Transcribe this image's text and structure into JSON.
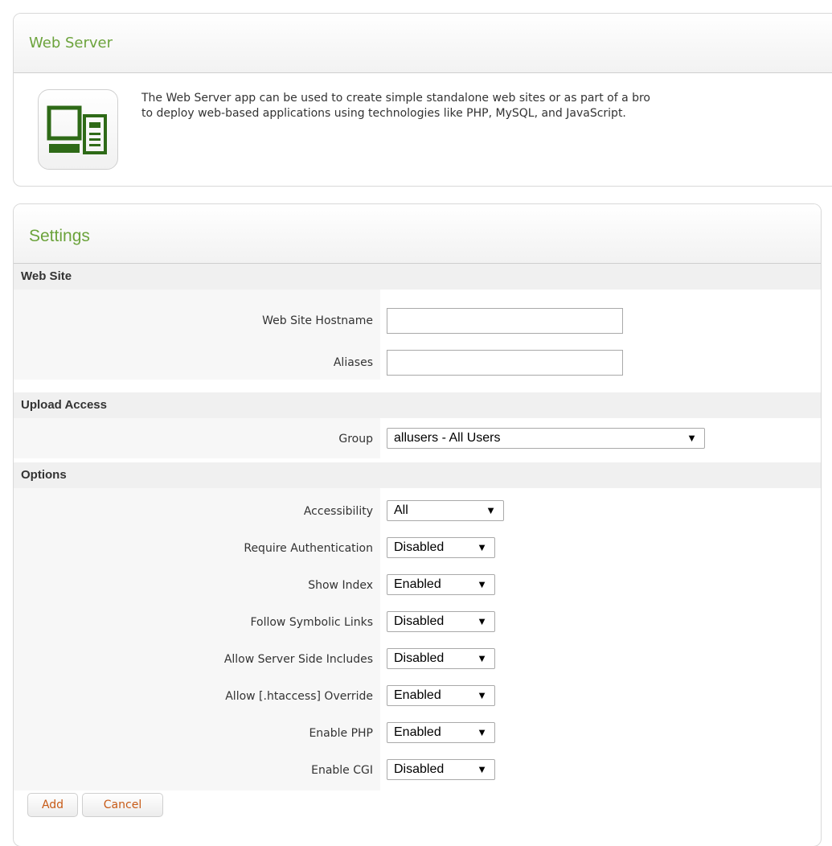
{
  "app": {
    "title": "Web Server",
    "icon": "web-server-icon",
    "description_line1": "The Web Server app can be used to create simple standalone web sites or as part of a bro",
    "description_line2": "to deploy web-based applications using technologies like PHP, MySQL, and JavaScript."
  },
  "settings": {
    "title": "Settings",
    "sections": {
      "web_site": "Web Site",
      "upload_access": "Upload Access",
      "options": "Options"
    },
    "fields": {
      "hostname": {
        "label": "Web Site Hostname",
        "value": ""
      },
      "aliases": {
        "label": "Aliases",
        "value": ""
      },
      "group": {
        "label": "Group",
        "value": "allusers - All Users"
      },
      "accessibility": {
        "label": "Accessibility",
        "value": "All"
      },
      "require_auth": {
        "label": "Require Authentication",
        "value": "Disabled"
      },
      "show_index": {
        "label": "Show Index",
        "value": "Enabled"
      },
      "follow_symlinks": {
        "label": "Follow Symbolic Links",
        "value": "Disabled"
      },
      "ssi": {
        "label": "Allow Server Side Includes",
        "value": "Disabled"
      },
      "htaccess": {
        "label": "Allow [.htaccess] Override",
        "value": "Enabled"
      },
      "php": {
        "label": "Enable PHP",
        "value": "Enabled"
      },
      "cgi": {
        "label": "Enable CGI",
        "value": "Disabled"
      }
    },
    "buttons": {
      "add": "Add",
      "cancel": "Cancel"
    }
  },
  "icons": {
    "dropdown_arrow": "▼"
  },
  "colors": {
    "accent_green": "#6ca33c",
    "button_text": "#c75a16",
    "section_bg": "#f0f0f0"
  }
}
